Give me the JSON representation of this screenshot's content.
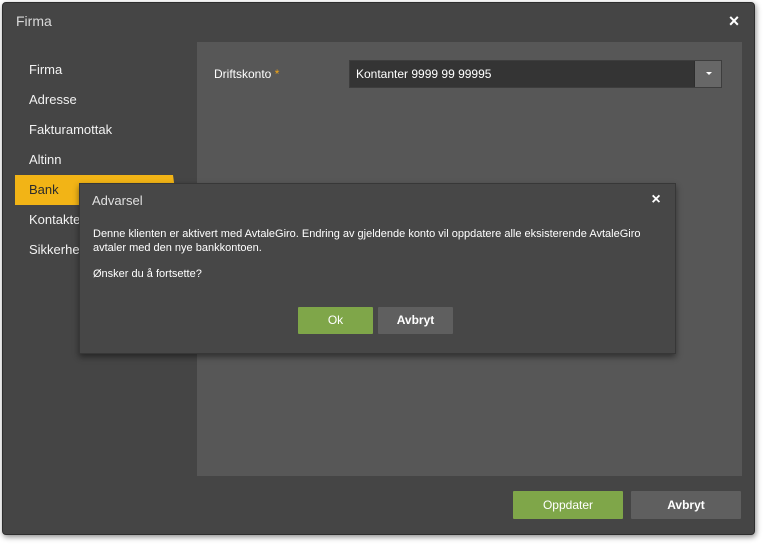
{
  "dialog": {
    "title": "Firma",
    "close_glyph": "×",
    "close_icon": "close-icon"
  },
  "sidebar": {
    "items": [
      {
        "label": "Firma",
        "active": false
      },
      {
        "label": "Adresse",
        "active": false
      },
      {
        "label": "Fakturamottak",
        "active": false
      },
      {
        "label": "Altinn",
        "active": false
      },
      {
        "label": "Bank",
        "active": true
      },
      {
        "label": "Kontakter",
        "active": false
      },
      {
        "label": "Sikkerhet",
        "active": false
      }
    ]
  },
  "form": {
    "driftskonto_label": "Driftskonto",
    "required_marker": "*",
    "driftskonto_value": "Kontanter 9999 99 99995",
    "dropdown_icon": "chevron-down-icon"
  },
  "footer": {
    "update_label": "Oppdater",
    "cancel_label": "Avbryt"
  },
  "warning_modal": {
    "title": "Advarsel",
    "close_glyph": "×",
    "message": "Denne klienten er aktivert med AvtaleGiro. Endring av gjeldende konto vil oppdatere alle eksisterende AvtaleGiro avtaler med den nye bankkontoen.",
    "question": "Ønsker du å fortsette?",
    "ok_label": "Ok",
    "cancel_label": "Avbryt"
  },
  "colors": {
    "background": "#454545",
    "panel": "#575757",
    "accent_active": "#f2b416",
    "primary_button": "#7fa649",
    "secondary_button": "#5f5f5f",
    "required_marker": "#f2a516"
  }
}
